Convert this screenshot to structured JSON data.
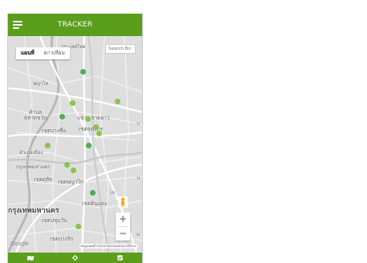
{
  "app": {
    "title": "TRACKER",
    "accent_color": "#5a9e1c",
    "menu_icon": "hamburger-icon"
  },
  "map": {
    "type_tabs": [
      {
        "label": "แผนที่",
        "active": true
      },
      {
        "label": "ดาวเทียม",
        "active": false
      }
    ],
    "search_placeholder": "Search Bo",
    "labels": {
      "top_area": "ประเทศไทย",
      "phaya_thai": "พญาไท",
      "talat": "ตำบล",
      "talat2": "ตลาดขวัญ",
      "bang_sue": "แขวง ลาดยาว",
      "khet_bangsue": "เขตบางซื่อ",
      "khet_chatuchak": "เขตจตุจักร",
      "bangkrachao": "อำเภอเมือง",
      "bangphlat": "กรุงเทพมหานคร",
      "khet_dusit": "เขตดุสิต",
      "khet_phayathai": "เขตพญาไท",
      "khet_dinDaeng": "เขตดินแดง",
      "krungthep": "กรุงเทพมหานคร",
      "pathumwan": "เขตปทุมวัน",
      "bangrak": "เขตบางรัก",
      "right_edge_1": "ป",
      "right_edge_2": "เข",
      "right_edge_3": "ป",
      "right_edge_4": "ม"
    },
    "markers": [
      {
        "color": "#4caf50"
      },
      {
        "color": "#8bc34a"
      },
      {
        "color": "#8bc34a"
      },
      {
        "color": "#4caf50"
      },
      {
        "color": "#8bc34a"
      },
      {
        "color": "#8bc34a"
      },
      {
        "color": "#8bc34a"
      },
      {
        "color": "#4caf50"
      },
      {
        "color": "#8bc34a"
      },
      {
        "color": "#8bc34a"
      },
      {
        "color": "#8bc34a"
      },
      {
        "color": "#4caf50"
      },
      {
        "color": "#8bc34a"
      }
    ],
    "zoom_in": "+",
    "zoom_out": "−",
    "google_logo": "Google",
    "attribution": "ข้อมูลแผนที่ ©2020 ข้อกำหนดในการใช้งาน"
  },
  "bottom_nav": {
    "icons": [
      "map-icon",
      "settings-icon",
      "checkbox-icon"
    ]
  }
}
